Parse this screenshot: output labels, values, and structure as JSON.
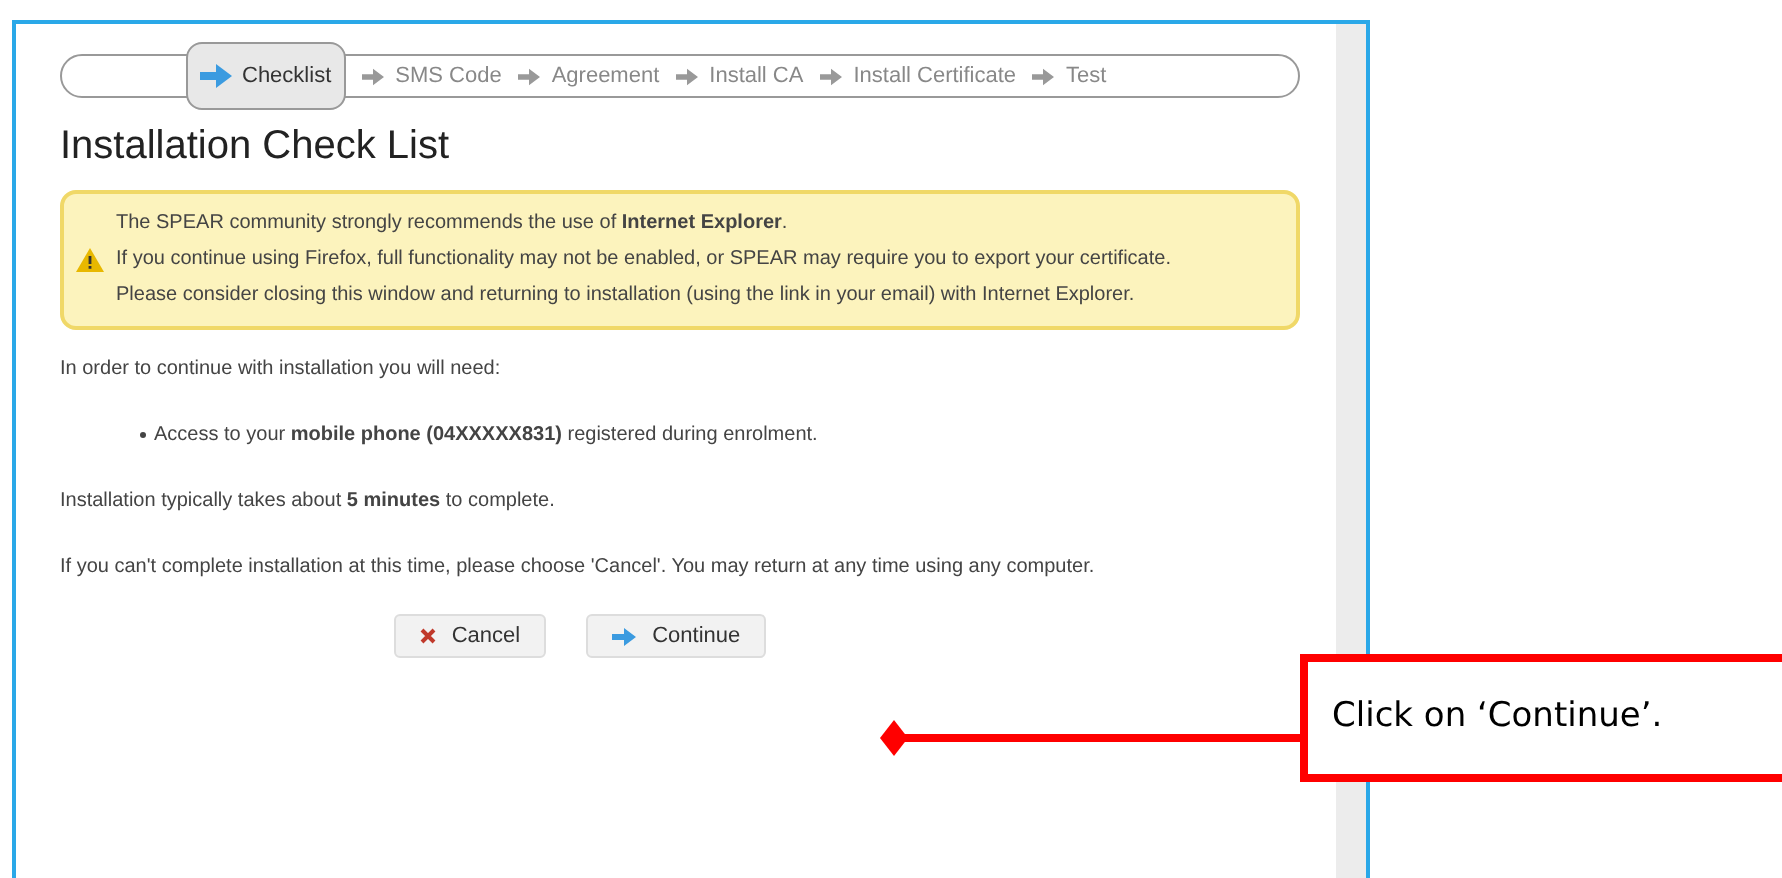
{
  "steps": [
    {
      "label": "Checklist",
      "selected": true
    },
    {
      "label": "SMS Code",
      "selected": false
    },
    {
      "label": "Agreement",
      "selected": false
    },
    {
      "label": "Install CA",
      "selected": false
    },
    {
      "label": "Install Certificate",
      "selected": false
    },
    {
      "label": "Test",
      "selected": false
    }
  ],
  "title": "Installation Check List",
  "warning": [
    "The SPEAR community strongly recommends the use of **Internet Explorer**.",
    "If you continue using Firefox, full functionality may not be enabled, or SPEAR may require you to export your certificate.",
    "Please consider closing this window and returning to installation (using the link in your email) with Internet Explorer."
  ],
  "intro": "In order to continue with installation you will need:",
  "requirements": [
    "Access to your **mobile phone (04XXXXX831)** registered during enrolment."
  ],
  "paragraphs": [
    "Installation typically takes about **5 minutes** to complete.",
    "If you can't complete installation at this time, please choose 'Cancel'. You may return at any time using any computer."
  ],
  "buttons": [
    {
      "label": "Cancel",
      "kind": "cancel"
    },
    {
      "label": "Continue",
      "kind": "continue"
    }
  ],
  "callout": "Click on ‘Continue’."
}
